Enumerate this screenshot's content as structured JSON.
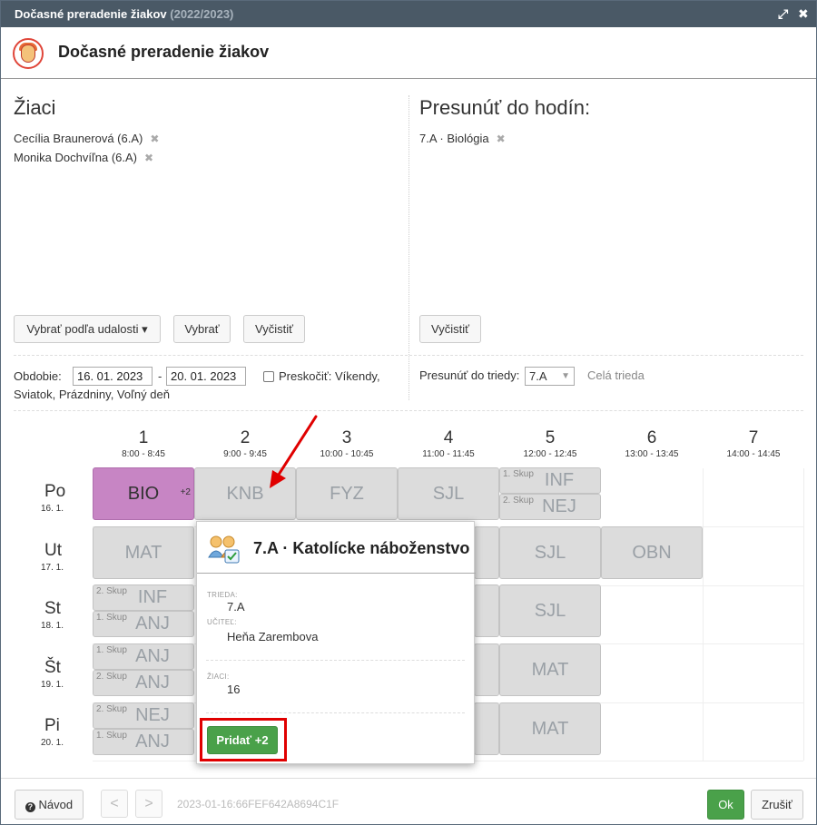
{
  "window": {
    "title": "Dočasné preradenie žiakov",
    "year": "(2022/2023)"
  },
  "header": {
    "title": "Dočasné preradenie žiakov"
  },
  "students": {
    "title": "Žiaci",
    "items": [
      {
        "label": "Cecília Braunerová (6.A)"
      },
      {
        "label": "Monika Dochvíľna (6.A)"
      }
    ],
    "btn_by_event": "Vybrať podľa udalosti ▾",
    "btn_select": "Vybrať",
    "btn_clear": "Vyčistiť"
  },
  "move_to": {
    "title": "Presunúť do hodín:",
    "items": [
      {
        "label": "7.A · Biológia"
      }
    ],
    "btn_clear": "Vyčistiť"
  },
  "period": {
    "label": "Obdobie:",
    "from": "16. 01. 2023",
    "sep": "-",
    "to": "20. 01. 2023",
    "skip_label": "Preskočiť: Víkendy,",
    "skip_label2": "Sviatok, Prázdniny, Voľný deň"
  },
  "move_class": {
    "label": "Presunúť do triedy:",
    "value": "7.A",
    "whole": "Celá trieda"
  },
  "periods": [
    {
      "num": "1",
      "time": "8:00 - 8:45"
    },
    {
      "num": "2",
      "time": "9:00 - 9:45"
    },
    {
      "num": "3",
      "time": "10:00 - 10:45"
    },
    {
      "num": "4",
      "time": "11:00 - 11:45"
    },
    {
      "num": "5",
      "time": "12:00 - 12:45"
    },
    {
      "num": "6",
      "time": "13:00 - 13:45"
    },
    {
      "num": "7",
      "time": "14:00 - 14:45"
    }
  ],
  "days": [
    {
      "name": "Po",
      "date": "16. 1."
    },
    {
      "name": "Ut",
      "date": "17. 1."
    },
    {
      "name": "St",
      "date": "18. 1."
    },
    {
      "name": "Št",
      "date": "19. 1."
    },
    {
      "name": "Pi",
      "date": "20. 1."
    }
  ],
  "lessons": {
    "po": {
      "bio": "BIO",
      "bio_plus": "+2",
      "knb": "KNB",
      "fyz": "FYZ",
      "sjl": "SJL",
      "p5a_grp": "1. Skup",
      "p5a": "INF",
      "p5b_grp": "2. Skup",
      "p5b": "NEJ"
    },
    "ut": {
      "mat": "MAT",
      "sjl": "SJL",
      "obn": "OBN"
    },
    "st": {
      "p1a_grp": "2. Skup",
      "p1a": "INF",
      "p1b_grp": "1. Skup",
      "p1b": "ANJ",
      "sjl": "SJL"
    },
    "stv": {
      "p1a_grp": "1. Skup",
      "p1a": "ANJ",
      "p1b_grp": "2. Skup",
      "p1b": "ANJ",
      "mat": "MAT"
    },
    "pi": {
      "p1a_grp": "2. Skup",
      "p1a": "NEJ",
      "p1b_grp": "1. Skup",
      "p1b": "ANJ",
      "mat": "MAT"
    }
  },
  "popup": {
    "title": "7.A · Katolícke náboženstvo",
    "class_label": "TRIEDA:",
    "class_value": "7.A",
    "teacher_label": "UČITEĽ:",
    "teacher_value": "Heňa Zarembova",
    "students_label": "ŽIACI:",
    "students_value": "16",
    "add_button": "Pridať +2"
  },
  "footer": {
    "help": "Návod",
    "prev": "<",
    "next": ">",
    "token": "2023-01-16:66FEF642A8694C1F",
    "ok": "Ok",
    "cancel": "Zrušiť"
  },
  "colors": {
    "titlebar": "#4a5966",
    "selected_lesson": "#c785c4",
    "lesson_cell": "#dcdcdc",
    "primary_button": "#4aa14a",
    "highlight": "#e00000"
  }
}
